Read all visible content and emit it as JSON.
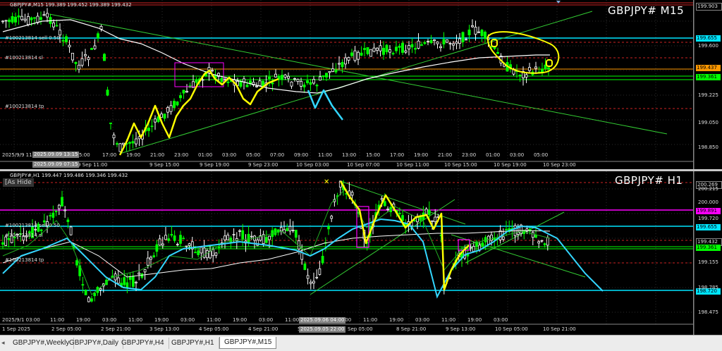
{
  "chart_m15": {
    "header": "GBPJPY#,M15  199.389 199.452 199.389 199.432",
    "symbol_title": "GBPJPY# M15",
    "order_labels": [
      "#100213814 sell 0.50",
      "#100213814 sl",
      "#100213814 tp"
    ],
    "price_labels": [
      {
        "text": "199.903",
        "bg": "#000000",
        "fg": "#dddddd",
        "border": "#888888"
      },
      {
        "text": "199.655",
        "bg": "#00e5ff",
        "fg": "#000000"
      },
      {
        "text": "199.437",
        "bg": "#ff9900",
        "fg": "#000000"
      },
      {
        "text": "199.361",
        "bg": "#00ff00",
        "fg": "#000000"
      }
    ],
    "price_ticks": [
      "199.600",
      "199.225",
      "199.050",
      "198.850"
    ],
    "time_ticks": [
      "17:00",
      "19:00",
      "21:00",
      "23:00",
      "01:00",
      "03:00",
      "05:00",
      "07:00",
      "09:00",
      "11:00",
      "13:00",
      "15:00",
      "17:00",
      "19:00",
      "21:00",
      "23:00",
      "01:00",
      "03:00",
      "05:00"
    ],
    "date_ticks": [
      "9 Sep 2025",
      "9 Sep 11:00",
      "9 Sep 15:00",
      "9 Sep 19:00",
      "9 Sep 23:00",
      "10 Sep 03:00",
      "10 Sep 07:00",
      "10 Sep 11:00",
      "10 Sep 15:00",
      "10 Sep 19:00",
      "10 Sep 23:00"
    ],
    "time_start": "2025/9/9 11",
    "crosshair_labels": [
      "2025.09.09 13:15",
      "2025.09.09 07:15"
    ],
    "crosshair_extra": "5:00"
  },
  "chart_h1": {
    "header": "GBPJPY#,H1  199.447 199.486 199.346 199.432",
    "symbol_title": "GBPJPY# H1",
    "as_hide": "[As Hide",
    "order_labels": [
      "#100213814 sell 0.50",
      "#100213814 sl",
      "#100213814 tp"
    ],
    "price_labels": [
      {
        "text": "200.269",
        "bg": "#000000",
        "fg": "#dddddd",
        "border": "#888888"
      },
      {
        "text": "199.891",
        "bg": "#ff00ff",
        "fg": "#000000"
      },
      {
        "text": "199.655",
        "bg": "#00e5ff",
        "fg": "#000000"
      },
      {
        "text": "199.432",
        "bg": "#000000",
        "fg": "#dddddd",
        "border": "#888888"
      },
      {
        "text": "199.361",
        "bg": "#00ff00",
        "fg": "#000000"
      },
      {
        "text": "198.720",
        "bg": "#00e5ff",
        "fg": "#000000"
      }
    ],
    "price_ticks": [
      "200.215",
      "200.000",
      "199.720",
      "199.155",
      "198.785",
      "198.475"
    ],
    "time_ticks": [
      "03:00",
      "11:00",
      "19:00",
      "03:00",
      "11:00",
      "19:00",
      "03:00",
      "11:00",
      "19:00",
      "03:00",
      "11:00",
      "19:00",
      "03:00",
      "11:00",
      "19:00",
      "03:00",
      "11:00",
      "19:00",
      "03:00"
    ],
    "date_ticks": [
      "1 Sep 2025",
      "2 Sep 05:00",
      "2 Sep 21:00",
      "3 Sep 13:00",
      "4 Sep 05:00",
      "4 Sep 21:00",
      "5 Sep 13:00",
      "Sep 05:00",
      "8 Sep 21:00",
      "9 Sep 13:00",
      "10 Sep 05:00",
      "10 Sep 21:00"
    ],
    "time_start": "2025/9/1 03:00",
    "crosshair_labels": [
      "2025.09.06 04:00",
      "2025.09.05 22:00"
    ]
  },
  "tabs": [
    "GBPJPY#,Weekly",
    "GBPJPY#,Daily",
    "GBPJPY#,H4",
    "GBPJPY#,H1",
    "GBPJPY#,M15"
  ],
  "active_tab": "GBPJPY#,M15",
  "colors": {
    "background": "#000000",
    "bull_candle": "#00ff00",
    "bear_candle": "#ffffff",
    "fast_ma": "#ffffff",
    "cyan_ma": "#33d6ff",
    "drawing_yellow": "#ffff00",
    "trend_line": "#33cc33",
    "sl_line": "#cc2222",
    "magenta": "#ff00ff"
  }
}
